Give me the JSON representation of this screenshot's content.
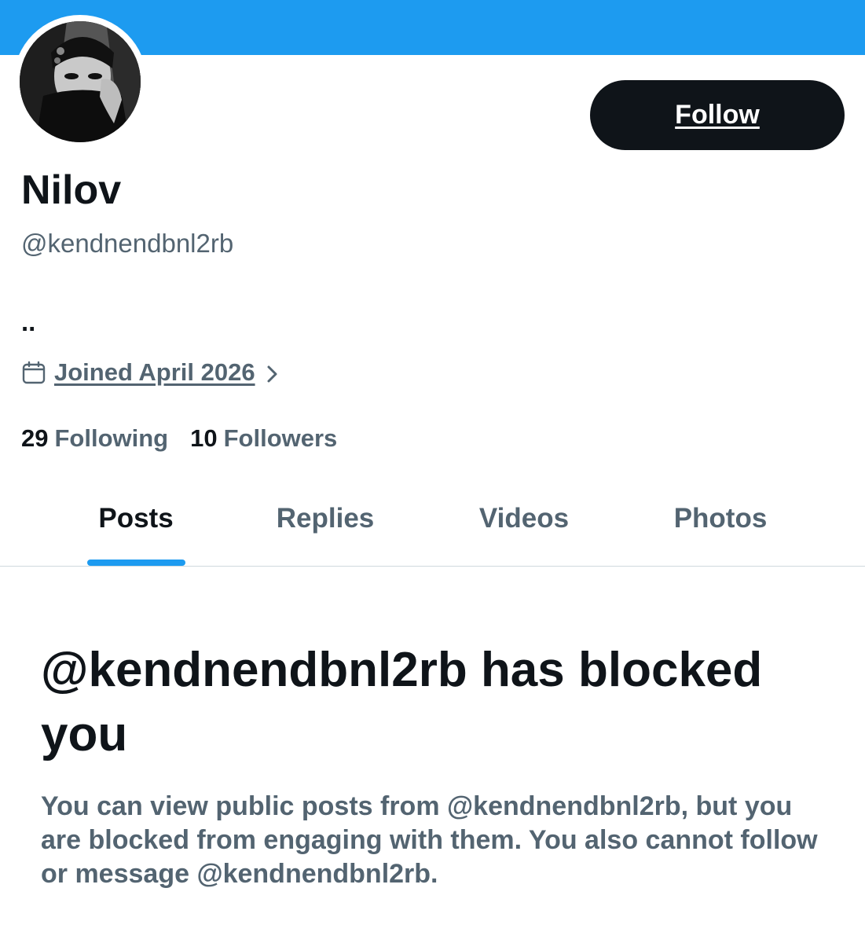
{
  "profile": {
    "display_name": "Nilov",
    "handle": "@kendnendbnl2rb",
    "bio": "..",
    "joined": "Joined April 2026",
    "following_count": "29",
    "following_label": "Following",
    "followers_count": "10",
    "followers_label": "Followers"
  },
  "actions": {
    "follow_label": "Follow"
  },
  "tabs": [
    {
      "label": "Posts",
      "active": true
    },
    {
      "label": "Replies",
      "active": false
    },
    {
      "label": "Videos",
      "active": false
    },
    {
      "label": "Photos",
      "active": false
    }
  ],
  "blocked_notice": {
    "title": "@kendnendbnl2rb has blocked you",
    "description": "You can view public posts from @kendnendbnl2rb, but you are blocked from engaging with them. You also cannot follow or message @kendnendbnl2rb."
  },
  "colors": {
    "accent": "#1d9bf0",
    "text_primary": "#0f1419",
    "text_secondary": "#536471",
    "button_bg": "#0f1419",
    "divider": "#cfd9de"
  },
  "icons": {
    "joined": "calendar-icon",
    "joined_more": "chevron-right-icon"
  }
}
